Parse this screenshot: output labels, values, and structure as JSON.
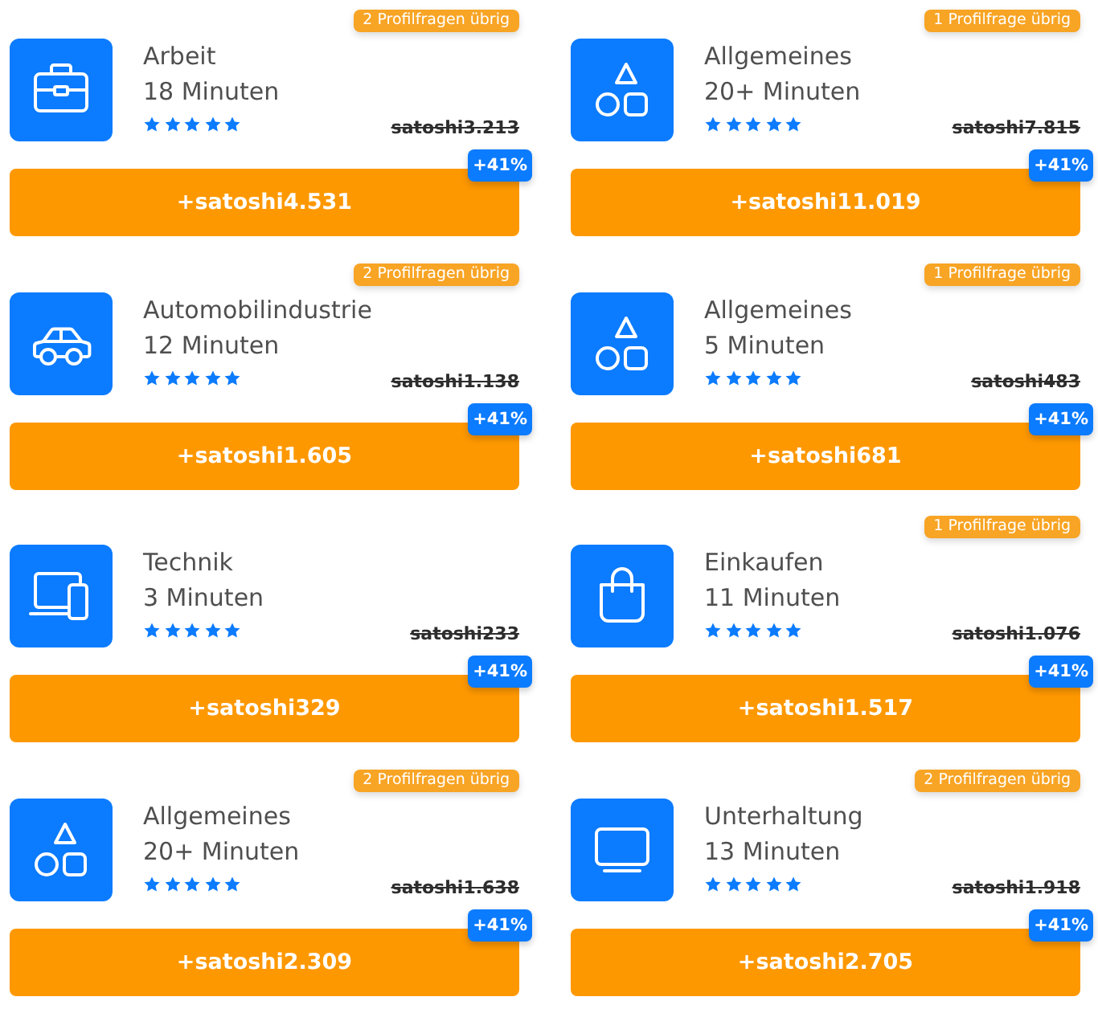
{
  "rows": [
    {
      "cards": [
        {
          "profile_badge": "2 Profilfragen übrig",
          "title": "Arbeit",
          "duration": "18 Minuten",
          "stars": 5,
          "old_price": "satoshi3.213",
          "reward": "+satoshi4.531",
          "bonus": "+41%"
        },
        {
          "profile_badge": "1 Profilfrage übrig",
          "title": "Allgemeines",
          "duration": "20+ Minuten",
          "stars": 5,
          "old_price": "satoshi7.815",
          "reward": "+satoshi11.019",
          "bonus": "+41%"
        }
      ]
    },
    {
      "cards": [
        {
          "profile_badge": "2 Profilfragen übrig",
          "title": "Automobilindustrie",
          "duration": "12 Minuten",
          "stars": 5,
          "old_price": "satoshi1.138",
          "reward": "+satoshi1.605",
          "bonus": "+41%"
        },
        {
          "profile_badge": "1 Profilfrage übrig",
          "title": "Allgemeines",
          "duration": "5 Minuten",
          "stars": 5,
          "old_price": "satoshi483",
          "reward": "+satoshi681",
          "bonus": "+41%"
        }
      ]
    },
    {
      "cards": [
        {
          "title": "Technik",
          "duration": "3 Minuten",
          "stars": 5,
          "old_price": "satoshi233",
          "reward": "+satoshi329",
          "bonus": "+41%"
        },
        {
          "profile_badge": "1 Profilfrage übrig",
          "title": "Einkaufen",
          "duration": "11 Minuten",
          "stars": 5,
          "old_price": "satoshi1.076",
          "reward": "+satoshi1.517",
          "bonus": "+41%"
        }
      ]
    },
    {
      "cards": [
        {
          "profile_badge": "2 Profilfragen übrig",
          "title": "Allgemeines",
          "duration": "20+ Minuten",
          "stars": 5,
          "old_price": "satoshi1.638",
          "reward": "+satoshi2.309",
          "bonus": "+41%"
        },
        {
          "profile_badge": "2 Profilfragen übrig",
          "title": "Unterhaltung",
          "duration": "13 Minuten",
          "stars": 5,
          "old_price": "satoshi1.918",
          "reward": "+satoshi2.705",
          "bonus": "+41%"
        }
      ]
    }
  ]
}
